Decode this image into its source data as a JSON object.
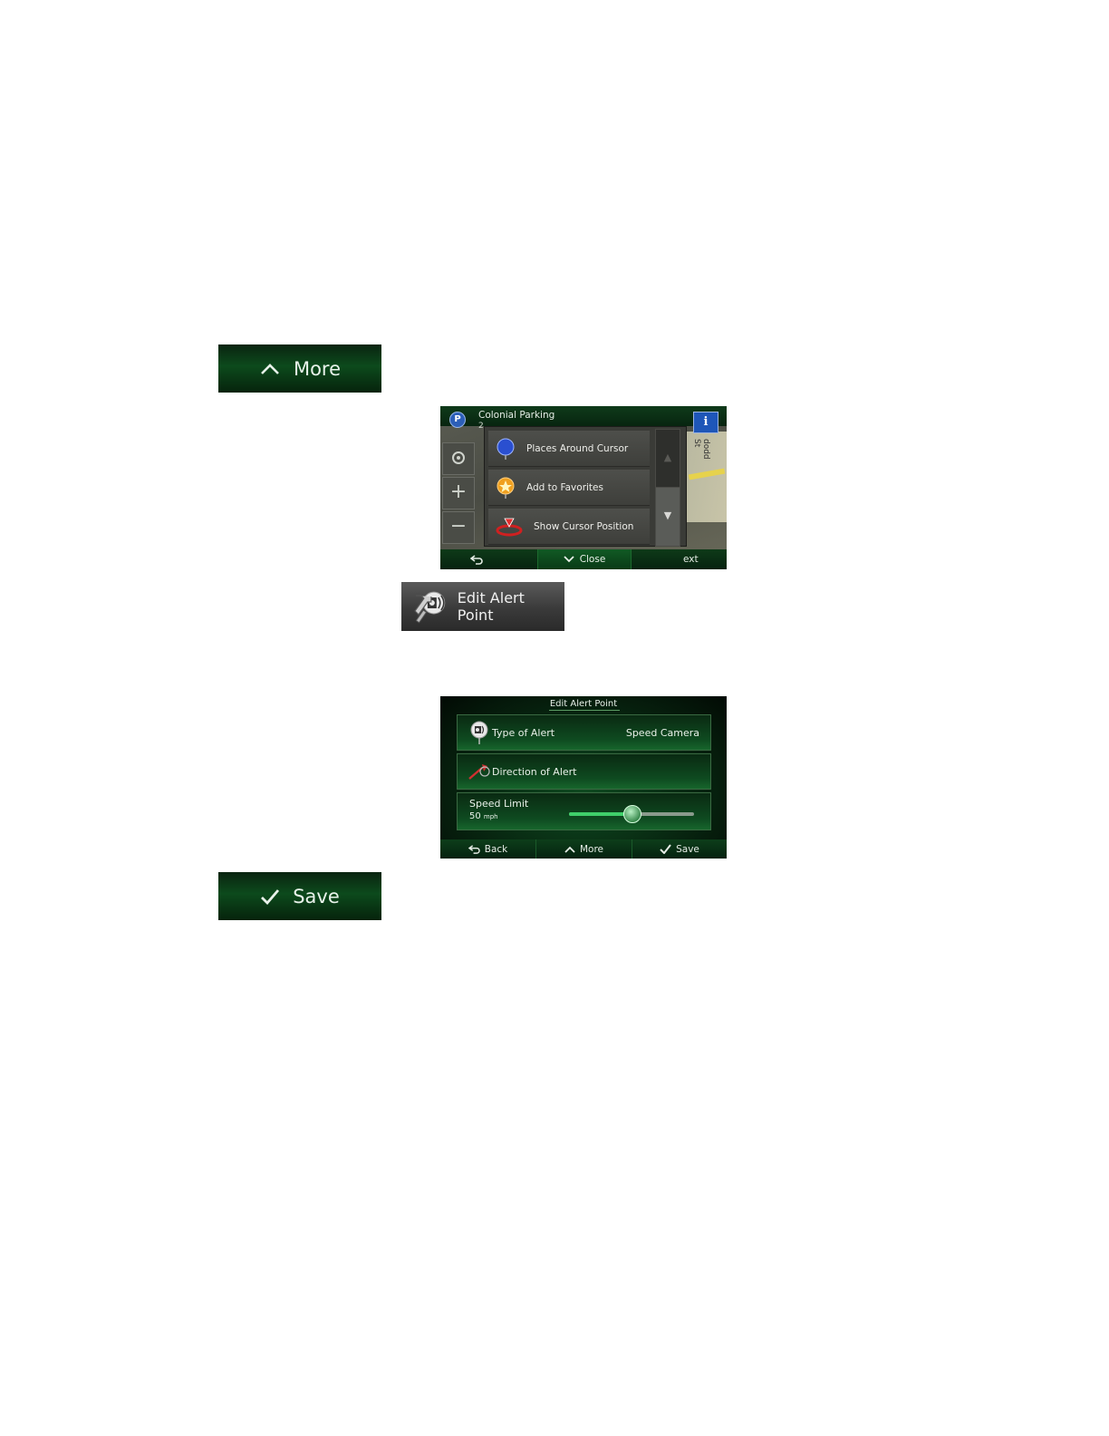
{
  "buttons": {
    "more_label": "More",
    "edit_alert_point_label": "Edit Alert Point",
    "save_label": "Save"
  },
  "screen1": {
    "place_title": "Colonial Parking",
    "place_sub": "2",
    "street_label": "dodd St",
    "menu_items": [
      {
        "label": "Places Around Cursor",
        "icon": "blue-pin-icon"
      },
      {
        "label": "Add to Favorites",
        "icon": "favorite-star-pin-icon"
      },
      {
        "label": "Show Cursor Position",
        "icon": "cursor-position-icon"
      }
    ],
    "close_label": "Close",
    "next_label": "ext"
  },
  "screen2": {
    "title": "Edit Alert Point",
    "type_label": "Type of Alert",
    "type_value": "Speed Camera",
    "direction_label": "Direction of Alert",
    "speed_label": "Speed Limit",
    "speed_value": "50",
    "speed_unit": "mph",
    "speed_fraction": 0.5,
    "bottom": {
      "back": "Back",
      "more": "More",
      "save": "Save"
    }
  },
  "colors": {
    "accent_green": "#0c4a1c",
    "slider_fill": "#3fcf6a",
    "info_blue": "#1e56b8"
  }
}
